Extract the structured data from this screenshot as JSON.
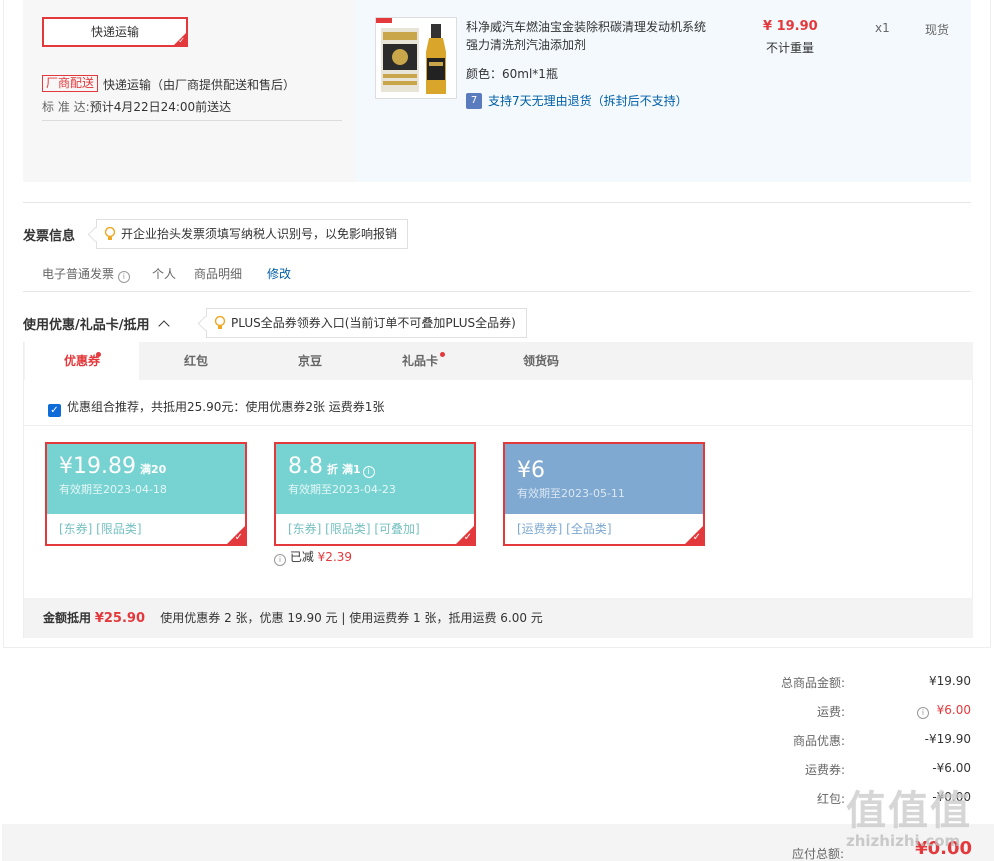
{
  "shipping": {
    "method_button": "快递运输",
    "vendor_tag": "厂商配送",
    "vendor_text": "快递运输（由厂商提供配送和售后）",
    "eta_label": "标 准 达:",
    "eta_text": "预计4月22日24:00前送达"
  },
  "product": {
    "name": "科净威汽车燃油宝金装除积碳清理发动机系统强力清洗剂汽油添加剂",
    "color_label": "颜色：",
    "color_value": "60ml*1瓶",
    "return_icon": "7",
    "return_text": "支持7天无理由退货（拆封后不支持）",
    "price": "¥ 19.90",
    "weight": "不计重量",
    "qty": "x1",
    "stock": "现货"
  },
  "invoice": {
    "title": "发票信息",
    "tip": "开企业抬头发票须填写纳税人识别号，以免影响报销",
    "type": "电子普通发票",
    "info_icon": "i",
    "holder": "个人",
    "content": "商品明细",
    "edit": "修改"
  },
  "discount": {
    "title": "使用优惠/礼品卡/抵用",
    "toggle_icon": "^",
    "tip": "PLUS全品券领券入口(当前订单不可叠加PLUS全品券)",
    "tabs": [
      {
        "label": "优惠券",
        "dot": true
      },
      {
        "label": "红包",
        "dot": false
      },
      {
        "label": "京豆",
        "dot": false
      },
      {
        "label": "礼品卡",
        "dot": true
      },
      {
        "label": "领货码",
        "dot": false
      }
    ],
    "combo_check": "✓",
    "combo_text": "优惠组合推荐，共抵用25.90元：使用优惠券2张 运费券1张",
    "coupons": [
      {
        "amount": "¥19.89",
        "cond": "满20",
        "valid": "有效期至2023-04-18",
        "tags": "[东券]  [限品类]"
      },
      {
        "amount": "8.8",
        "unit": "折",
        "cond": "满1",
        "cond_icon": "i",
        "valid": "有效期至2023-04-23",
        "tags": "[东券]  [限品类]  [可叠加]"
      },
      {
        "amount": "¥6",
        "valid": "有效期至2023-05-11",
        "tags": "[运费券]  [全品类]"
      }
    ],
    "check_mark": "✓",
    "reduced_icon": "i",
    "reduced_label": "已减",
    "reduced_value": "¥2.39",
    "summary_label": "金额抵用",
    "summary_amount": "¥25.90",
    "summary_text": "使用优惠券 2 张，优惠 19.90 元  | 使用运费券 1 张，抵用运费 6.00 元"
  },
  "totals": {
    "goods_label": "总商品金额:",
    "goods_value": "¥19.90",
    "freight_label": "运费:",
    "freight_icon": "i",
    "freight_value": "¥6.00",
    "discount_label": "商品优惠:",
    "discount_value": "-¥19.90",
    "freight_coupon_label": "运费券:",
    "freight_coupon_value": "-¥6.00",
    "redpack_label": "红包:",
    "redpack_value": "-¥0.00",
    "due_label": "应付总额:",
    "due_value": "¥0.00"
  },
  "watermark": {
    "logo": "值值值",
    "site": "zhizhizhi.com"
  },
  "colors": {
    "accent": "#e4393c",
    "coupon_teal": "#76d3d1",
    "coupon_blue": "#7fa9d1",
    "link": "#005ea7"
  }
}
